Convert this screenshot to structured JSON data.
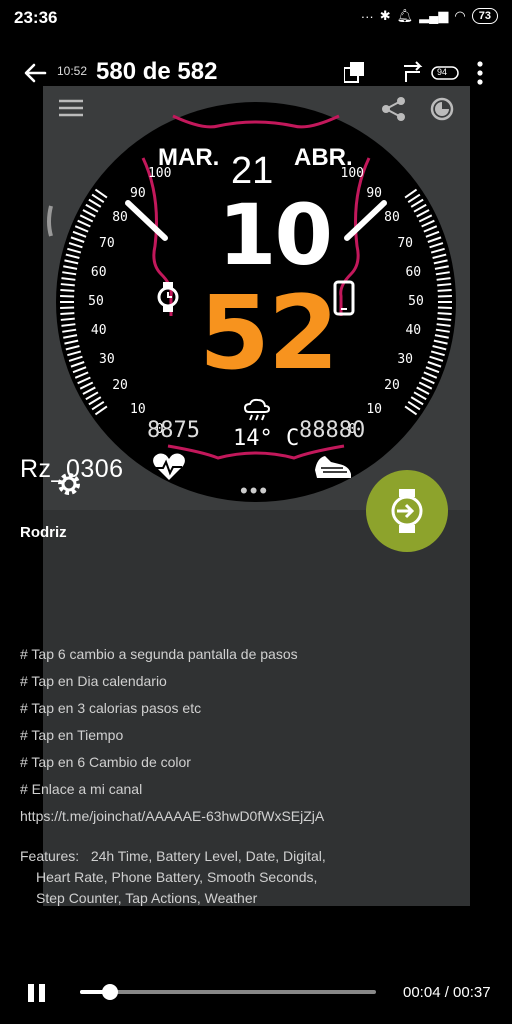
{
  "status_bar": {
    "time": "23:36",
    "battery": "73"
  },
  "viewer": {
    "time": "10:52",
    "title": "580 de 582",
    "battery_small": "94"
  },
  "watch": {
    "month": "MAR.",
    "day": "21",
    "month2": "ABR.",
    "hour": "10",
    "minute": "52",
    "left_digits": "8875",
    "weather": "14° C",
    "right_digits": "88880",
    "scale_left": [
      "100",
      "90",
      "80",
      "70",
      "60",
      "50",
      "40",
      "30",
      "20",
      "10",
      "0"
    ],
    "scale_right": [
      "100",
      "90",
      "80",
      "70",
      "60",
      "50",
      "40",
      "30",
      "20",
      "10",
      "0"
    ],
    "colors": {
      "accent_orange": "#f7931e",
      "accent_red": "#c2185b",
      "fab_green": "#8da32c"
    }
  },
  "details": {
    "name": "Rz_0306",
    "author": "Rodriz",
    "lines": [
      "# Tap 6 cambio a segunda pantalla de pasos",
      "# Tap en Dia calendario",
      "# Tap en 3 calorias pasos etc",
      "# Tap en Tiempo",
      "# Tap en 6 Cambio de color",
      "# Enlace a mi canal",
      "https://t.me/joinchat/AAAAAE-63hwD0fWxSEjZjA"
    ],
    "features_label": "Features:",
    "features_line1": "24h Time,  Battery Level,  Date,  Digital,",
    "features_line2": "Heart Rate,  Phone Battery,  Smooth Seconds,",
    "features_line3": "Step Counter,  Tap Actions,  Weather"
  },
  "player": {
    "progress": 0.1,
    "time": "00:04 / 00:37"
  },
  "icons": [
    "back-arrow-icon",
    "share-icon",
    "theme-icon",
    "menu-icon",
    "settings-icon",
    "watch-install-icon",
    "pause-icon",
    "more-icon"
  ]
}
